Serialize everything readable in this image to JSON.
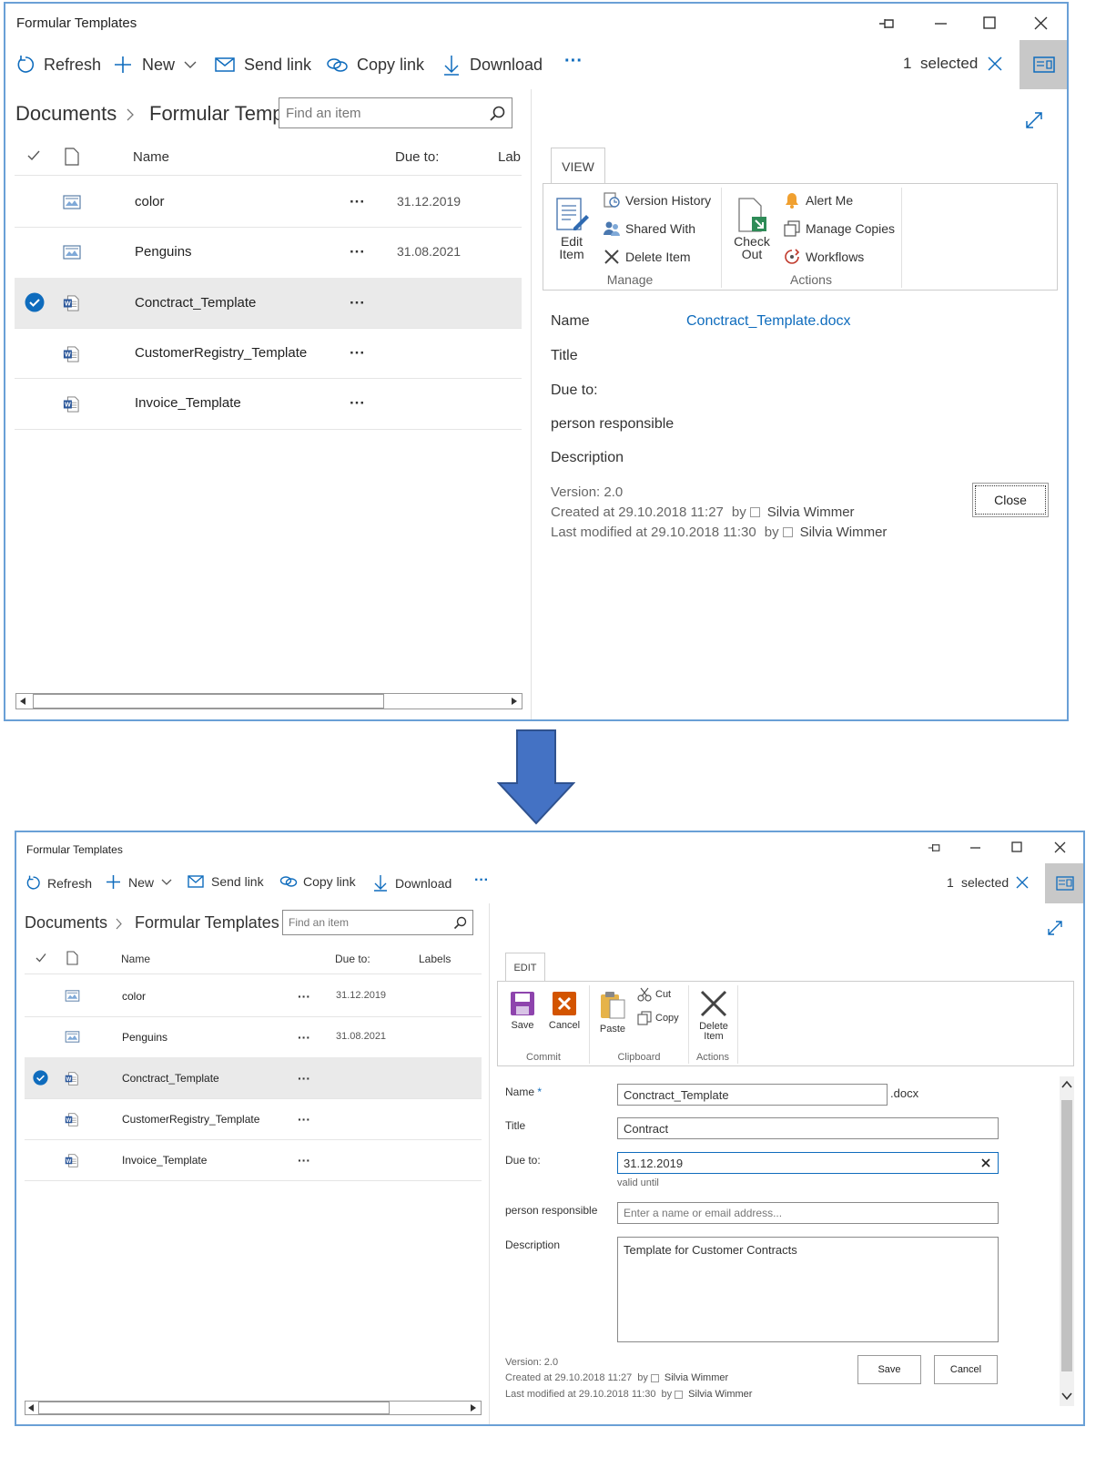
{
  "top": {
    "title": "Formular Templates",
    "toolbar": {
      "refresh": "Refresh",
      "new": "New",
      "send_link": "Send link",
      "copy_link": "Copy link",
      "download": "Download",
      "more": "···",
      "selected_count": "1",
      "selected_label": "selected"
    },
    "breadcrumb": {
      "root": "Documents",
      "current": "Formular Temp"
    },
    "search_placeholder": "Find an item",
    "columns": {
      "name": "Name",
      "due": "Due to:",
      "labels": "Lab"
    },
    "rows": [
      {
        "name": "color",
        "due": "31.12.2019",
        "type": "image"
      },
      {
        "name": "Penguins",
        "due": "31.08.2021",
        "type": "image"
      },
      {
        "name": "Conctract_Template",
        "due": "",
        "type": "word"
      },
      {
        "name": "CustomerRegistry_Template",
        "due": "",
        "type": "word"
      },
      {
        "name": "Invoice_Template",
        "due": "",
        "type": "word"
      }
    ],
    "row_more": "···",
    "ribbon": {
      "tab": "VIEW",
      "edit_item_1": "Edit",
      "edit_item_2": "Item",
      "version_history": "Version History",
      "shared_with": "Shared With",
      "delete_item": "Delete Item",
      "manage_group": "Manage",
      "check_out_1": "Check",
      "check_out_2": "Out",
      "alert_me": "Alert Me",
      "manage_copies": "Manage Copies",
      "workflows": "Workflows",
      "actions_group": "Actions"
    },
    "props": {
      "name_label": "Name",
      "name_value": "Conctract_Template.docx",
      "title_label": "Title",
      "due_label": "Due to:",
      "person_label": "person responsible",
      "desc_label": "Description"
    },
    "version": "Version: 2.0",
    "created": "Created at 29.10.2018 11:27",
    "modified": "Last modified at 29.10.2018 11:30",
    "by": "by",
    "author": "Silvia Wimmer",
    "close": "Close"
  },
  "bottom": {
    "title": "Formular Templates",
    "toolbar": {
      "refresh": "Refresh",
      "new": "New",
      "send_link": "Send link",
      "copy_link": "Copy link",
      "download": "Download",
      "more": "···",
      "selected_count": "1",
      "selected_label": "selected"
    },
    "breadcrumb": {
      "root": "Documents",
      "current": "Formular Templates"
    },
    "search_placeholder": "Find an item",
    "columns": {
      "name": "Name",
      "due": "Due to:",
      "labels": "Labels"
    },
    "rows": [
      {
        "name": "color",
        "due": "31.12.2019",
        "type": "image"
      },
      {
        "name": "Penguins",
        "due": "31.08.2021",
        "type": "image"
      },
      {
        "name": "Conctract_Template",
        "due": "",
        "type": "word"
      },
      {
        "name": "CustomerRegistry_Template",
        "due": "",
        "type": "word"
      },
      {
        "name": "Invoice_Template",
        "due": "",
        "type": "word"
      }
    ],
    "row_more": "···",
    "ribbon": {
      "tab": "EDIT",
      "save": "Save",
      "cancel": "Cancel",
      "commit_group": "Commit",
      "paste": "Paste",
      "cut": "Cut",
      "copy": "Copy",
      "clipboard_group": "Clipboard",
      "delete_item_1": "Delete",
      "delete_item_2": "Item",
      "actions_group": "Actions"
    },
    "form": {
      "name_label": "Name",
      "required_mark": "*",
      "name_value": "Conctract_Template",
      "name_ext": ".docx",
      "title_label": "Title",
      "title_value": "Contract",
      "due_label": "Due to:",
      "due_value": "31.12.2019",
      "due_hint": "valid until",
      "person_label": "person responsible",
      "person_placeholder": "Enter a name or email address...",
      "desc_label": "Description",
      "desc_value": "Template for Customer Contracts"
    },
    "version": "Version: 2.0",
    "created": "Created at 29.10.2018 11:27",
    "modified": "Last modified at 29.10.2018 11:30",
    "by": "by",
    "author": "Silvia Wimmer",
    "save": "Save",
    "cancel": "Cancel"
  },
  "colors": {
    "accent": "#0f6cbd",
    "arrow": "#4472c4",
    "window_border": "#6aa0d6"
  }
}
